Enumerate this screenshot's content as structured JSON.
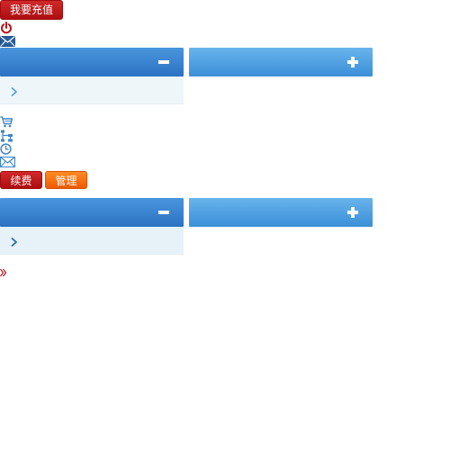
{
  "recharge_button": {
    "label": "我要充值"
  },
  "top_icons": [
    "power-icon",
    "envelope-icon"
  ],
  "panel_1": {
    "left_header_toggle": "minus",
    "right_header_toggle": "plus",
    "row_icon": "chevron-right-icon"
  },
  "service_icons": [
    "cart-icon",
    "network-icon",
    "clock-icon",
    "envelope-icon"
  ],
  "renew_button": {
    "label": "续费"
  },
  "manage_button": {
    "label": "管理"
  },
  "panel_2": {
    "left_header_toggle": "minus",
    "right_header_toggle": "plus",
    "row_icon": "chevron-right-icon"
  },
  "footer_icon": "double-chevron-right-icon",
  "colors": {
    "red_button": "#c01c1e",
    "orange_button": "#f47214",
    "header_blue_dark": "#3a83d0",
    "header_blue_light": "#55a4e4",
    "row_background": "#eef6f9",
    "icon_blue": "#3f86c7",
    "power_red": "#b3161a"
  }
}
